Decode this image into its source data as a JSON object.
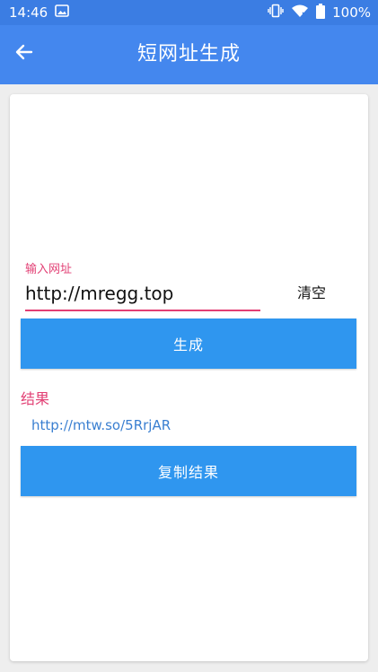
{
  "status_bar": {
    "time": "14:46",
    "battery": "100%",
    "icons": [
      "image-icon",
      "vibrate-icon",
      "wifi-icon",
      "battery-icon"
    ]
  },
  "app_bar": {
    "title": "短网址生成",
    "back_icon": "arrow-left-icon"
  },
  "form": {
    "input_label": "输入网址",
    "input_value": "http://mregg.top",
    "clear_label": "清空",
    "generate_label": "生成"
  },
  "result": {
    "label": "结果",
    "value": "http://mtw.so/5RrjAR",
    "copy_label": "复制结果"
  },
  "colors": {
    "status_bar": "#3b7de3",
    "app_bar": "#4487ee",
    "accent_pink": "#e23f74",
    "button_blue": "#2f96ef",
    "link_blue": "#3a7fd1"
  }
}
